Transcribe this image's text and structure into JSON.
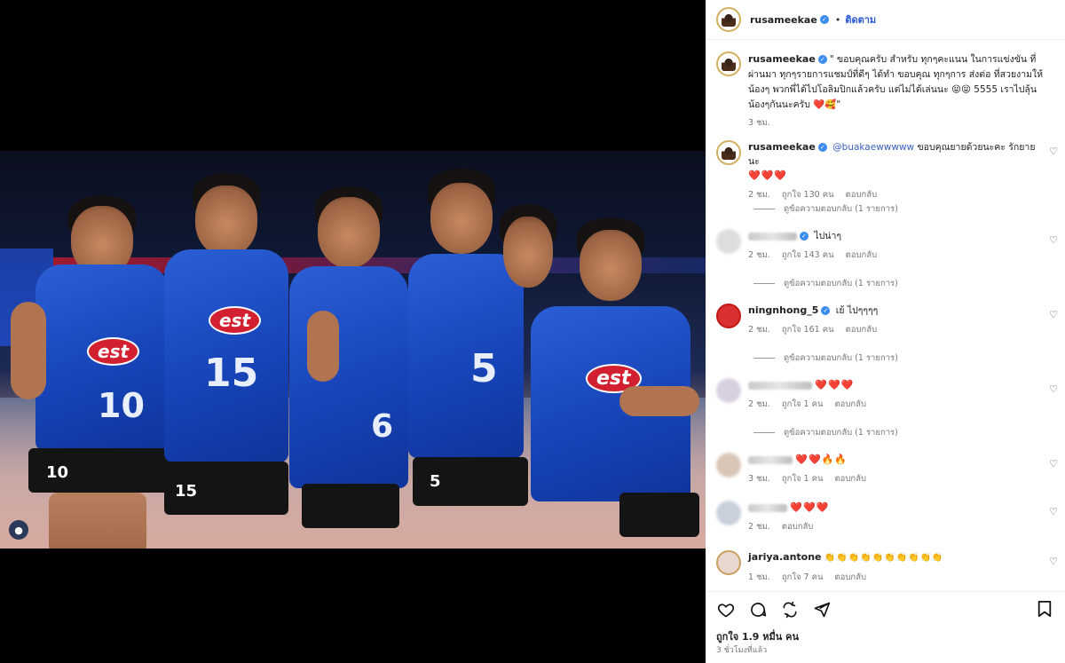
{
  "post": {
    "author": "rusameekae",
    "follow_label": "ติดตาม",
    "dot": "•",
    "caption": "\" ขอบคุณครับ สำหรับ ทุกๆคะแนน ในการแข่งขัน ที่ผ่านมา ทุกๆรายการแชมป์ที่ดีๆ ได้ทำ ขอบคุณ ทุกๆการ ส่งต่อ ที่สวยงามให้ น้องๆ พวกพี่ได้ไปโอลิมปิกแล้วครับ แต่ไม่ได้เล่นนะ 😝😝 5555 เราไปลุ้นน้องๆกันนะครับ ❤️🥰\"",
    "caption_time": "3 ชม."
  },
  "photo": {
    "jersey_numbers": [
      "10",
      "15",
      "6",
      "5"
    ],
    "short_numbers": [
      "10",
      "15",
      "5"
    ],
    "brand": "est"
  },
  "comments": [
    {
      "user": "rusameekae",
      "mention": "@buakaewwwww",
      "text": "ขอบคุณยายด้วยนะคะ รักยายนะ",
      "hearts": "❤️❤️❤️",
      "time": "2 ชม.",
      "likes": "ถูกใจ 130 คน",
      "reply": "ตอบกลับ",
      "view_replies": "ดูข้อความตอบกลับ (1 รายการ)"
    },
    {
      "user": "",
      "text": "ไปน่าๆ",
      "time": "2 ชม.",
      "likes": "ถูกใจ 143 คน",
      "reply": "ตอบกลับ",
      "view_replies": "ดูข้อความตอบกลับ (1 รายการ)"
    },
    {
      "user": "ningnhong_5",
      "text": "เย้ ไปๆๆๆๆ",
      "time": "2 ชม.",
      "likes": "ถูกใจ 161 คน",
      "reply": "ตอบกลับ",
      "view_replies": "ดูข้อความตอบกลับ (1 รายการ)"
    },
    {
      "user": "",
      "hearts": "❤️❤️❤️",
      "time": "2 ชม.",
      "likes": "ถูกใจ 1 คน",
      "reply": "ตอบกลับ",
      "view_replies": "ดูข้อความตอบกลับ (1 รายการ)"
    },
    {
      "user": "",
      "hearts": "❤️❤️🔥🔥",
      "time": "3 ชม.",
      "likes": "ถูกใจ 1 คน",
      "reply": "ตอบกลับ"
    },
    {
      "user": "",
      "hearts": "❤️❤️❤️",
      "time": "2 ชม.",
      "reply": "ตอบกลับ"
    },
    {
      "user": "jariya.antone",
      "hearts": "👏👏👏👏👏👏👏👏👏👏",
      "time": "1 ชม.",
      "likes": "ถูกใจ 7 คน",
      "reply": "ตอบกลับ"
    }
  ],
  "footer": {
    "likes": "ถูกใจ 1.9 หมื่น คน",
    "ago": "3 ชั่วโมงที่แล้ว"
  },
  "colors": {
    "accent": "#2a5ad8",
    "verified": "#3b8bf0",
    "heart": "#e02030"
  },
  "icons": [
    "like-icon",
    "comment-icon",
    "share-icon",
    "send-icon",
    "bookmark-icon",
    "heart-outline-icon",
    "verified-icon"
  ]
}
